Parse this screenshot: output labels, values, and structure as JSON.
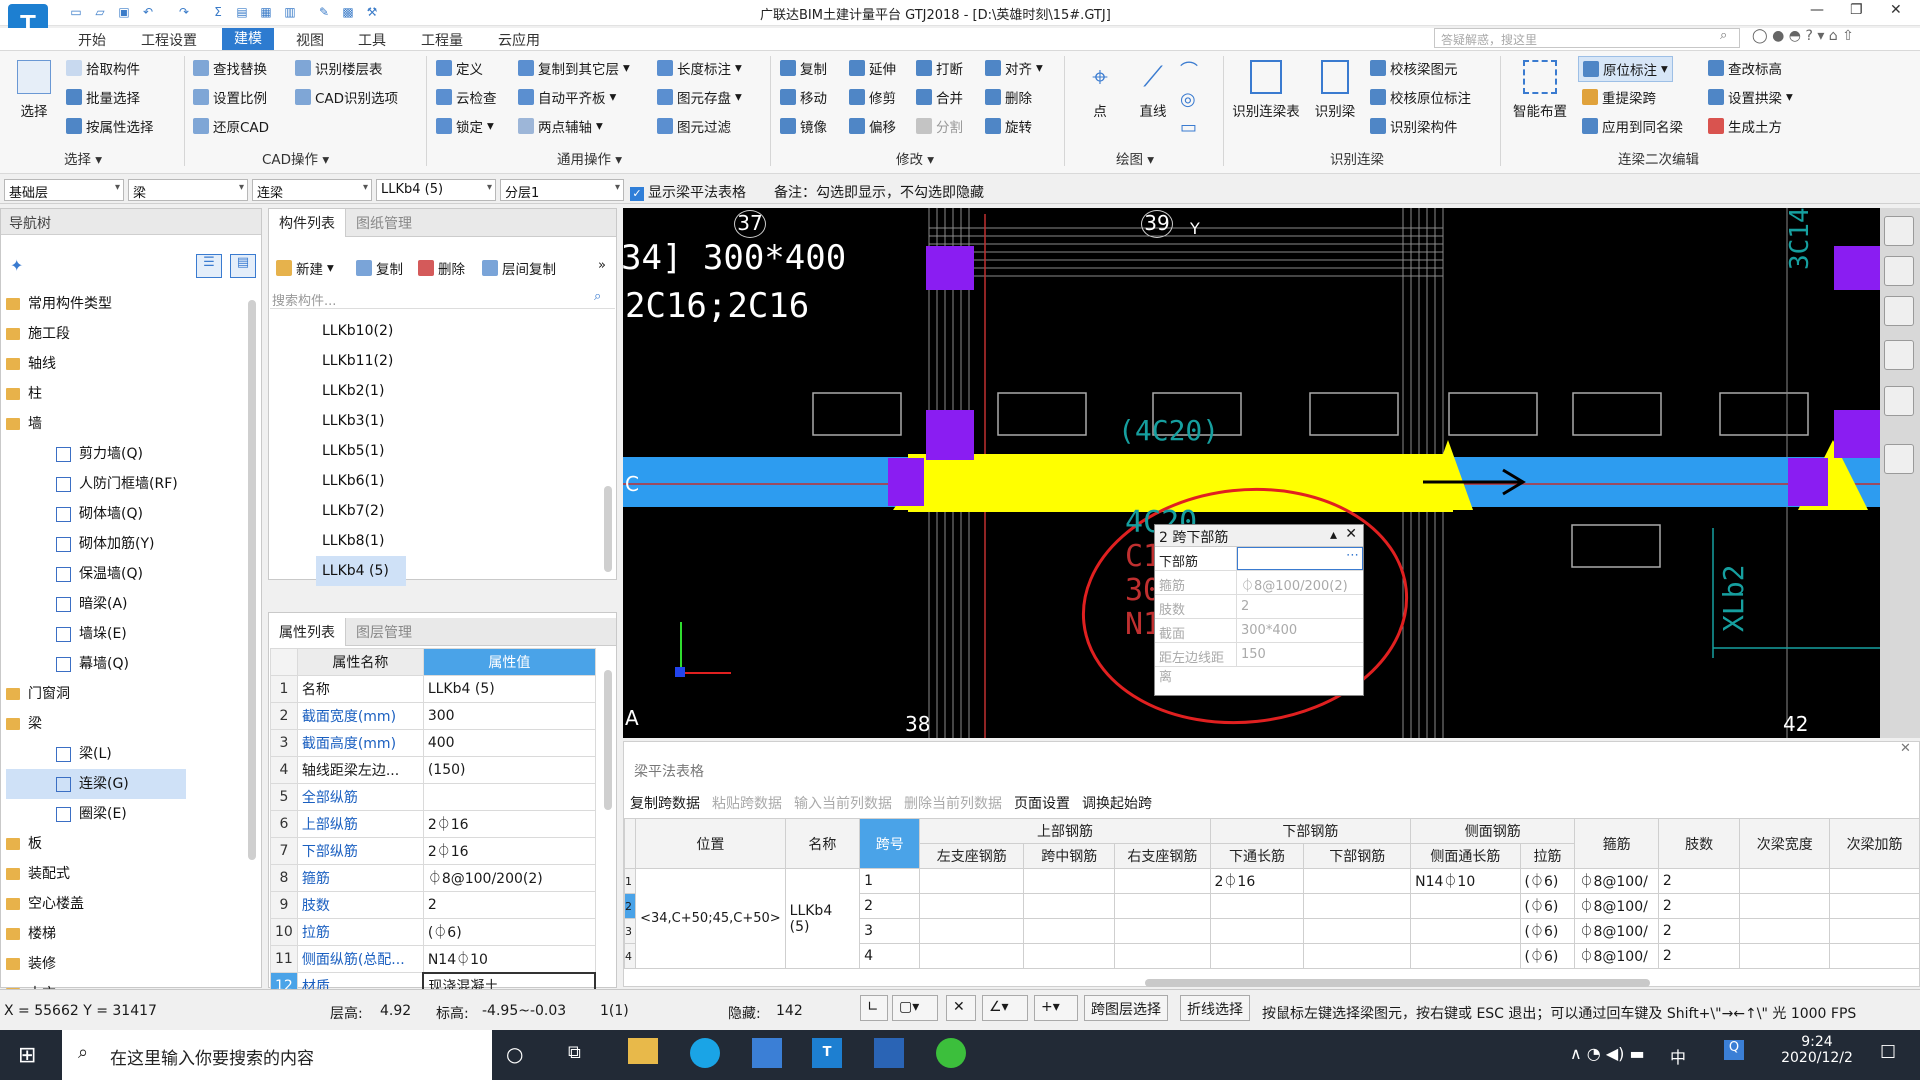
{
  "app": {
    "logo": "T",
    "title": "广联达BIM土建计量平台 GTJ2018 - [D:\\英雄时刻\\15#.GTJ]",
    "help_placeholder": "答疑解惑，搜这里"
  },
  "menus": [
    "开始",
    "工程设置",
    "建模",
    "视图",
    "工具",
    "工程量",
    "云应用"
  ],
  "active_menu": "建模",
  "ribbon": {
    "select": "选择",
    "select_items": [
      "拾取构件",
      "批量选择",
      "按属性选择"
    ],
    "find_items": [
      "查找替换",
      "设置比例",
      "还原CAD"
    ],
    "cad_items": [
      "识别楼层表",
      "CAD识别选项"
    ],
    "define_items": [
      "定义",
      "云检查",
      "锁定"
    ],
    "copy_items": [
      "复制到其它层",
      "自动平齐板",
      "两点辅轴"
    ],
    "length_items": [
      "长度标注",
      "图元存盘",
      "图元过滤"
    ],
    "modify1": [
      "复制",
      "移动",
      "镜像"
    ],
    "modify2": [
      "延伸",
      "修剪",
      "偏移"
    ],
    "modify3": [
      "打断",
      "合并",
      "分割"
    ],
    "modify4": [
      "对齐",
      "删除",
      "旋转"
    ],
    "draw": [
      "点",
      "直线"
    ],
    "recog": [
      "识别连梁表",
      "识别梁"
    ],
    "recog2": [
      "校核梁图元",
      "校核原位标注",
      "识别梁构件"
    ],
    "smart": "智能布置",
    "edit1": [
      "原位标注",
      "重提梁跨",
      "应用到同名梁"
    ],
    "edit2": [
      "查改标高",
      "设置拱梁",
      "生成土方"
    ],
    "groups": {
      "select": "选择",
      "cad": "CAD操作",
      "common": "通用操作",
      "modify": "修改",
      "draw": "绘图",
      "recog": "识别连梁",
      "edit": "连梁二次编辑"
    }
  },
  "filter": {
    "floor": "基础层",
    "type": "梁",
    "subtype": "连梁",
    "comp": "LLKb4 (5)",
    "layer": "分层1",
    "show_table": "显示梁平法表格",
    "note": "备注：勾选即显示，不勾选即隐藏"
  },
  "nav": {
    "title": "导航树",
    "items": [
      {
        "label": "常用构件类型",
        "level": 0
      },
      {
        "label": "施工段",
        "level": 0
      },
      {
        "label": "轴线",
        "level": 0
      },
      {
        "label": "柱",
        "level": 0
      },
      {
        "label": "墙",
        "level": 0
      },
      {
        "label": "剪力墙(Q)",
        "level": 1
      },
      {
        "label": "人防门框墙(RF)",
        "level": 1
      },
      {
        "label": "砌体墙(Q)",
        "level": 1
      },
      {
        "label": "砌体加筋(Y)",
        "level": 1
      },
      {
        "label": "保温墙(Q)",
        "level": 1
      },
      {
        "label": "暗梁(A)",
        "level": 1
      },
      {
        "label": "墙垛(E)",
        "level": 1
      },
      {
        "label": "幕墙(Q)",
        "level": 1
      },
      {
        "label": "门窗洞",
        "level": 0
      },
      {
        "label": "梁",
        "level": 0
      },
      {
        "label": "梁(L)",
        "level": 1
      },
      {
        "label": "连梁(G)",
        "level": 1,
        "active": true
      },
      {
        "label": "圈梁(E)",
        "level": 1
      },
      {
        "label": "板",
        "level": 0
      },
      {
        "label": "装配式",
        "level": 0
      },
      {
        "label": "空心楼盖",
        "level": 0
      },
      {
        "label": "楼梯",
        "level": 0
      },
      {
        "label": "装修",
        "level": 0
      },
      {
        "label": "土方",
        "level": 0
      }
    ]
  },
  "comp": {
    "tabs": [
      "构件列表",
      "图纸管理"
    ],
    "tools": [
      "新建",
      "复制",
      "删除",
      "层间复制"
    ],
    "search_placeholder": "搜索构件...",
    "items": [
      "LLKb10(2)",
      "LLKb11(2)",
      "LLKb2(1)",
      "LLKb3(1)",
      "LLKb5(1)",
      "LLKb6(1)",
      "LLKb7(2)",
      "LLKb8(1)",
      "LLKb4 (5)"
    ]
  },
  "props": {
    "tabs": [
      "属性列表",
      "图层管理"
    ],
    "head": [
      "属性名称",
      "属性值"
    ],
    "rows": [
      [
        "1",
        "名称",
        "LLKb4 (5)"
      ],
      [
        "2",
        "截面宽度(mm)",
        "300"
      ],
      [
        "3",
        "截面高度(mm)",
        "400"
      ],
      [
        "4",
        "轴线距梁左边...",
        "(150)"
      ],
      [
        "5",
        "全部纵筋",
        ""
      ],
      [
        "6",
        "上部纵筋",
        "2⏀16"
      ],
      [
        "7",
        "下部纵筋",
        "2⏀16"
      ],
      [
        "8",
        "箍筋",
        "⏀8@100/200(2)"
      ],
      [
        "9",
        "肢数",
        "2"
      ],
      [
        "10",
        "拉筋",
        "(⏀6)"
      ],
      [
        "11",
        "侧面纵筋(总配...",
        "N14⏀10"
      ],
      [
        "12",
        "材质",
        "现浇混凝土"
      ]
    ]
  },
  "canvas": {
    "axis_top": [
      "37",
      "39"
    ],
    "axis_bottom": [
      "38",
      "42"
    ],
    "axis_left": [
      "C",
      "A"
    ],
    "text1": "34] 300*400",
    "text2": "2C16;2C16",
    "text3": "(4C20)",
    "side_label1": "3C14",
    "side_label2": "XLb2",
    "ghost": [
      "4C20",
      "C1",
      "30",
      "N1"
    ],
    "popup": {
      "title": "2 跨下部筋",
      "rows": [
        [
          "下部筋",
          ""
        ],
        [
          "箍筋",
          "⏀8@100/200(2)"
        ],
        [
          "肢数",
          "2"
        ],
        [
          "截面",
          "300*400"
        ],
        [
          "距左边线距离",
          "150"
        ]
      ]
    }
  },
  "beamtable": {
    "title": "梁平法表格",
    "tools": [
      "复制跨数据",
      "粘贴跨数据",
      "输入当前列数据",
      "删除当前列数据",
      "页面设置",
      "调换起始跨"
    ],
    "head1": [
      "位置",
      "名称",
      "跨号",
      "上部钢筋",
      "下部钢筋",
      "侧面钢筋",
      "箍筋",
      "肢数",
      "次梁宽度",
      "次梁加筋"
    ],
    "head2": [
      "左支座钢筋",
      "跨中钢筋",
      "右支座钢筋",
      "下通长筋",
      "下部钢筋",
      "侧面通长筋",
      "拉筋"
    ],
    "position": "<34,C+50;45,C+50>",
    "name": "LLKb4 (5)",
    "rows": [
      [
        "1",
        "2⏀16",
        "N14⏀10",
        "(⏀6)",
        "⏀8@100/",
        "2"
      ],
      [
        "2",
        "",
        "",
        "(⏀6)",
        "⏀8@100/",
        "2"
      ],
      [
        "3",
        "",
        "",
        "(⏀6)",
        "⏀8@100/",
        "2"
      ],
      [
        "4",
        "",
        "",
        "(⏀6)",
        "⏀8@100/",
        "2"
      ]
    ]
  },
  "status": {
    "coords": "X = 55662 Y = 31417",
    "floor_h": "层高:",
    "floor_h_v": "4.92",
    "elev": "标高:",
    "elev_v": "-4.95~-0.03",
    "count": "1(1)",
    "hidden": "隐藏:",
    "hidden_v": "142",
    "b1": "跨图层选择",
    "b2": "折线选择",
    "hint": "按鼠标左键选择梁图元，按右键或 ESC 退出；可以通过回车键及 Shift+\\\"→←↑\\\" 光 1000 FPS"
  },
  "taskbar": {
    "search": "在这里输入你要搜索的内容",
    "time": "9:24",
    "date": "2020/12/2",
    "ime": "中"
  }
}
